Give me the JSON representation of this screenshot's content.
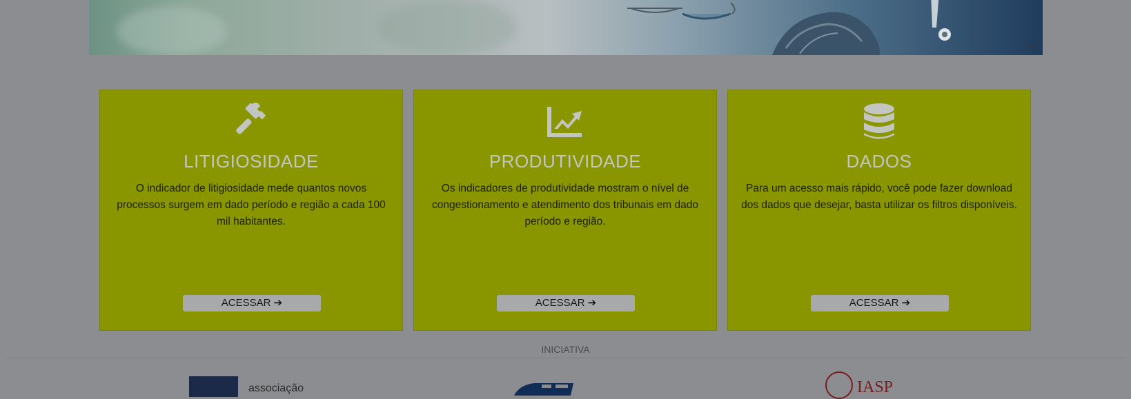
{
  "colors": {
    "background": "#8b8d90",
    "card": "#8a9600",
    "card_title": "#c3c5c1",
    "button": "#a8a9ab",
    "iasp_red": "#7a1d1d"
  },
  "cards": [
    {
      "icon": "gavel-icon",
      "title": "LITIGIOSIDADE",
      "description": "O indicador de litigiosidade mede quantos novos processos surgem em dado período e região a cada 100 mil habitantes.",
      "button": "ACESSAR ➔"
    },
    {
      "icon": "chart-line-icon",
      "title": "PRODUTIVIDADE",
      "description": "Os indicadores de produtividade mostram o nível de congestionamento e atendimento dos tribunais em dado período e região.",
      "button": "ACESSAR ➔"
    },
    {
      "icon": "database-icon",
      "title": "DADOS",
      "description": "Para um acesso mais rápido, você pode fazer download dos dados que desejar, basta utilizar os filtros disponíveis.",
      "button": "ACESSAR ➔"
    }
  ],
  "footer": {
    "heading": "INICIATIVA",
    "logos": {
      "assoc_text": "associação",
      "iasp_text": "IASP"
    }
  }
}
